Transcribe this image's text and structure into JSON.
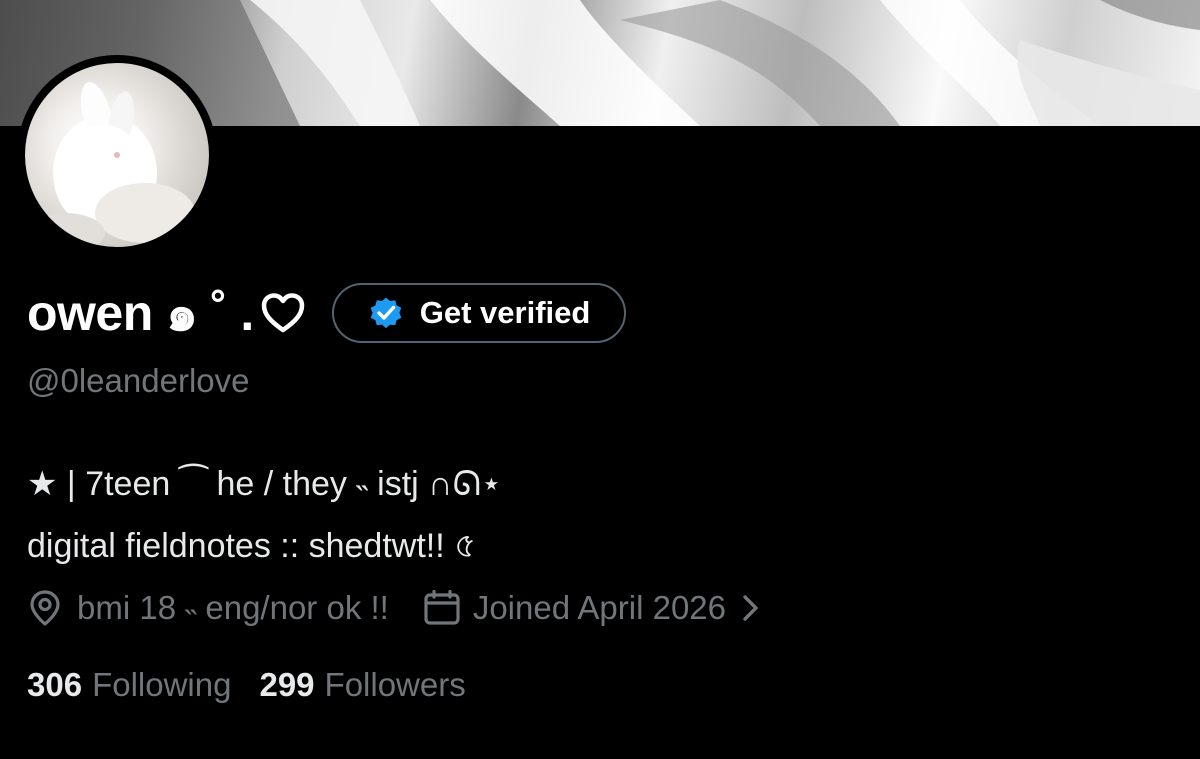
{
  "profile": {
    "display_name": "owen ๑ ˚ .",
    "handle": "@0leanderlove",
    "verify_button_label": "Get verified",
    "bio_line1": "★ | 7teen ⁀ he / they ˵ istj ∩ᘏ⋆",
    "bio_line2": "digital fieldnotes :: shedtwt!! ৫",
    "location": "bmi 18 ˵ eng/nor ok !!",
    "joined": "Joined April 2026"
  },
  "stats": {
    "following_count": "306",
    "following_label": "Following",
    "followers_count": "299",
    "followers_label": "Followers"
  },
  "icons": {
    "name_icon": "heart-outline-icon",
    "verify_icon": "verified-badge-icon",
    "location_icon": "location-pin-icon",
    "joined_icon": "calendar-icon",
    "joined_chevron": "chevron-right-icon"
  },
  "colors": {
    "background": "#000000",
    "text_primary": "#e7e9ea",
    "text_secondary": "#71767b",
    "verified_blue": "#1d9bf0",
    "button_border": "#536471"
  }
}
